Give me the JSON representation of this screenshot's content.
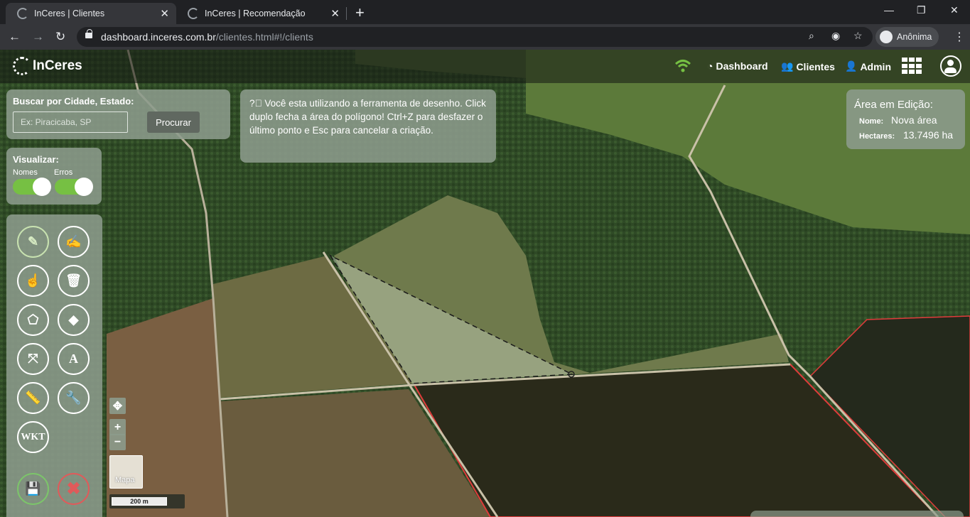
{
  "browser": {
    "tabs": [
      {
        "title": "InCeres | Clientes",
        "active": true
      },
      {
        "title": "InCeres | Recomendação",
        "active": false
      }
    ],
    "url_host": "dashboard.inceres.com.br",
    "url_path": "/clientes.html#!/clients",
    "profile_label": "Anônima"
  },
  "header": {
    "logo": "InCeres",
    "nav": {
      "dashboard": "Dashboard",
      "clientes": "Clientes",
      "admin": "Admin"
    },
    "wifi_color": "#76c043"
  },
  "search": {
    "label": "Buscar por Cidade, Estado:",
    "placeholder": "Ex: Piracicaba, SP",
    "button": "Procurar"
  },
  "visualize": {
    "title": "Visualizar:",
    "toggles": [
      {
        "label": "Nomes",
        "on": true
      },
      {
        "label": "Erros",
        "on": true
      }
    ]
  },
  "tools": {
    "wkt_label": "WKT",
    "text_label": "A",
    "cancel_glyph": "✖"
  },
  "info": {
    "message": "Você esta utilizando a ferramenta de desenho. Click duplo fecha a área do polígono! Ctrl+Z para desfazer o último ponto e Esc para cancelar a criação."
  },
  "edit_area": {
    "title": "Área em Edição:",
    "name_label": "Nome:",
    "name_value": "Nova área",
    "hectares_label": "Hectares:",
    "hectares_value": "13.7496 ha"
  },
  "map": {
    "basemap_label": "Mapa",
    "scale_label": "200 m",
    "zoom_in": "+",
    "zoom_out": "−",
    "boundary_color": "#e03b3b"
  }
}
